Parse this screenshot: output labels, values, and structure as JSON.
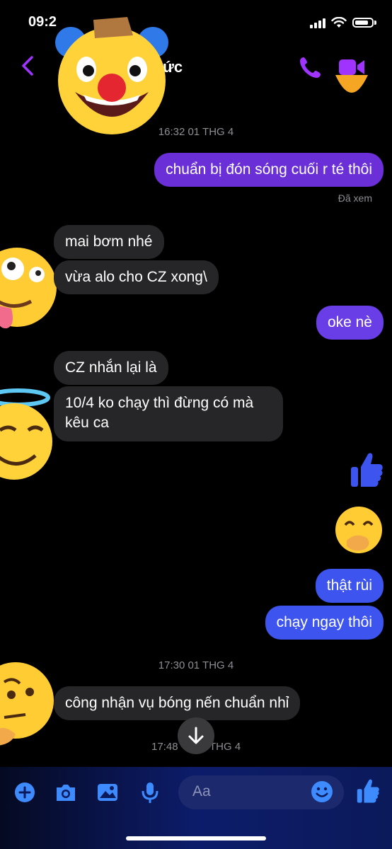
{
  "status_bar": {
    "time": "09:2"
  },
  "header": {
    "contact_name": "ức"
  },
  "timestamps": [
    "16:32 01 THG 4",
    "17:30 01 THG 4",
    "17:48",
    "THG 4"
  ],
  "messages": [
    {
      "side": "out",
      "text": "chuẩn bị đón sóng cuối r té thôi"
    },
    {
      "side": "status",
      "text": "Đã xem"
    },
    {
      "side": "in",
      "text": "mai bơm nhé"
    },
    {
      "side": "in",
      "text": "vừa alo cho CZ xong\\"
    },
    {
      "side": "out",
      "text": "oke nè"
    },
    {
      "side": "in",
      "text": "CZ nhắn lại là"
    },
    {
      "side": "in",
      "text": "10/4 ko chạy thì đừng có mà"
    },
    {
      "side": "in",
      "text": "kêu ca"
    },
    {
      "side": "out",
      "text": "thật rùi"
    },
    {
      "side": "out",
      "text": "chạy ngay thôi"
    },
    {
      "side": "in",
      "text": "công nhận vụ bóng nến chuẩn nhỉ"
    }
  ],
  "composer": {
    "placeholder": "Aa"
  },
  "colors": {
    "accent": "#a033ff",
    "bubble_in": "#262628",
    "bubble_out_purple": "#6a2fd6",
    "bubble_out_blue": "#3d55ee"
  },
  "icons": [
    "back-icon",
    "phone-icon",
    "video-icon",
    "thumbs-up-icon",
    "hand-over-mouth-emoji",
    "clown-face-emoji",
    "zany-face-emoji",
    "smiling-halo-emoji",
    "thinking-face-emoji",
    "scroll-down-icon",
    "plus-icon",
    "camera-icon",
    "gallery-icon",
    "microphone-icon",
    "smiley-icon"
  ]
}
